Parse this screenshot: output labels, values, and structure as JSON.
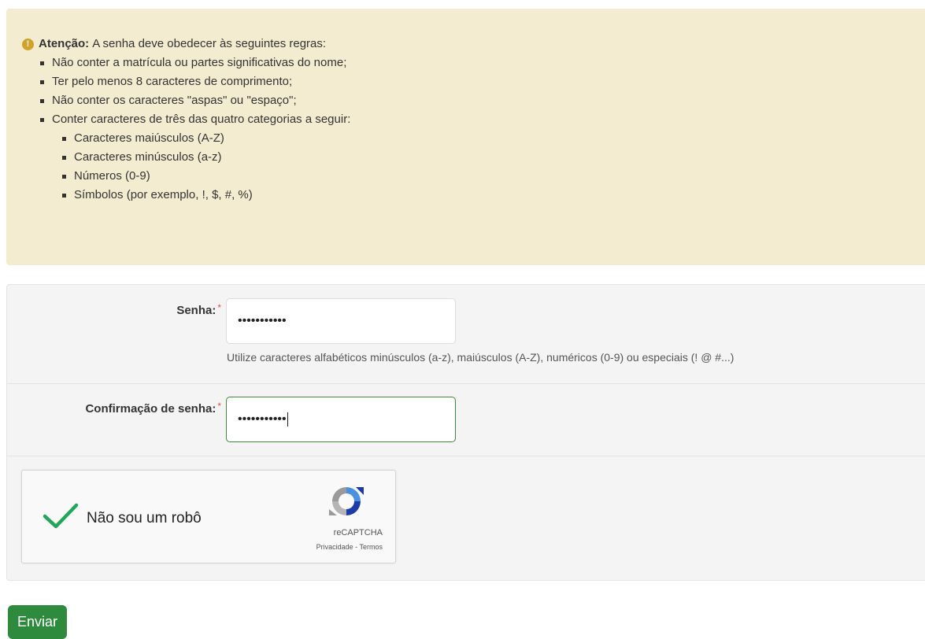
{
  "alert": {
    "icon": "exclamation-circle-icon",
    "icon_glyph": "!",
    "title": "Atenção:",
    "intro": "A senha deve obedecer às seguintes regras:",
    "rules": [
      "Não conter a matrícula ou partes significativas do nome;",
      "Ter pelo menos 8 caracteres de comprimento;",
      "Não conter os caracteres \"aspas\" ou \"espaço\";",
      "Conter caracteres de três das quatro categorias a seguir:"
    ],
    "categories": [
      "Caracteres maiúsculos (A-Z)",
      "Caracteres minúsculos (a-z)",
      "Números (0-9)",
      "Símbolos (por exemplo, !, $, #, %)"
    ],
    "color": "#f4ecd0"
  },
  "form": {
    "password": {
      "label": "Senha:",
      "required_mark": "*",
      "value": "•••••••••••",
      "help": "Utilize caracteres alfabéticos minúsculos (a-z), maiúsculos (A-Z), numéricos (0-9) ou especiais (! @ #...)"
    },
    "confirm": {
      "label": "Confirmação de senha:",
      "required_mark": "*",
      "value": "•••••••••••"
    }
  },
  "captcha": {
    "label": "Não sou um robô",
    "checked": true,
    "icon": "check-icon",
    "brand": "reCAPTCHA",
    "links": "Privacidade - Termos"
  },
  "submit": {
    "label": "Enviar",
    "color": "#2e8b3e"
  }
}
